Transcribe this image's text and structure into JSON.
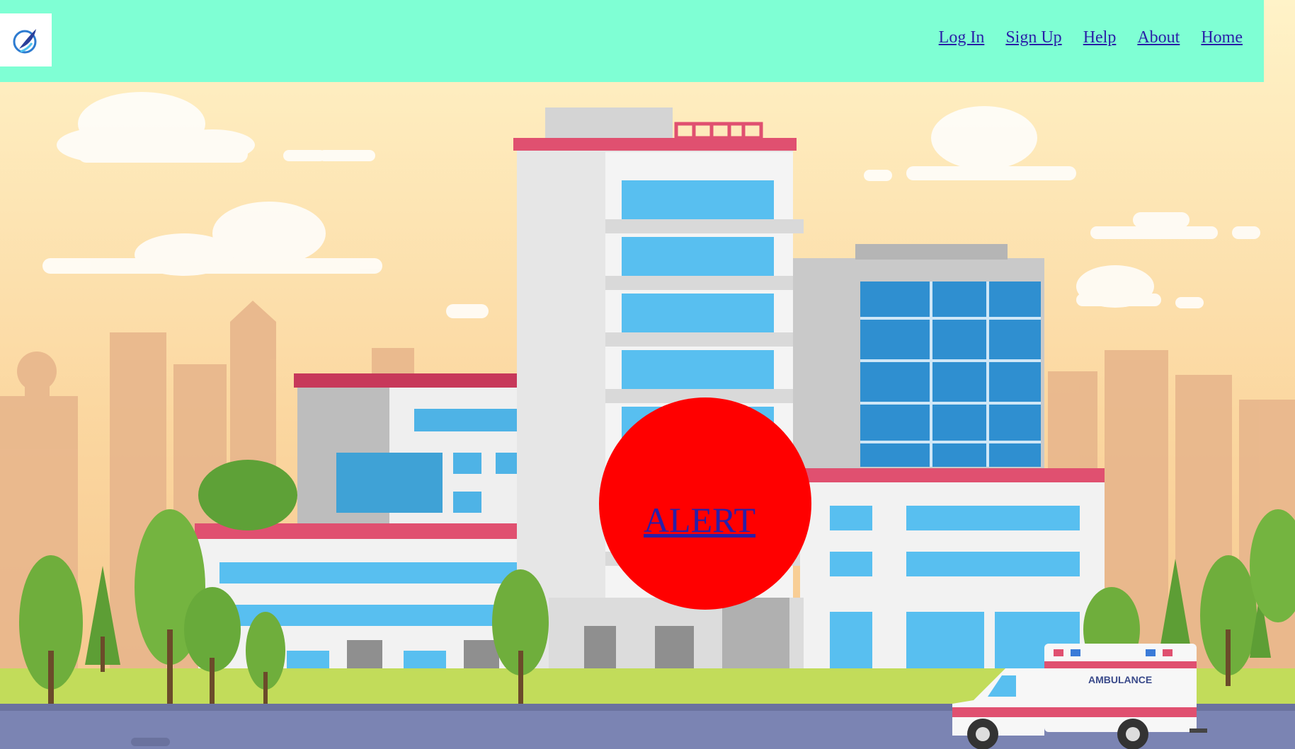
{
  "header": {
    "logo_icon": "feather-quill-logo-icon",
    "nav": [
      {
        "label": "Log In"
      },
      {
        "label": "Sign Up"
      },
      {
        "label": "Help"
      },
      {
        "label": "About"
      },
      {
        "label": "Home"
      }
    ]
  },
  "hero": {
    "illustration": "hospital-building-with-ambulance-illustration",
    "ambulance_text": "AMBULANCE"
  },
  "alert_button": {
    "label": "ALERT",
    "color": "#ff0000"
  },
  "colors": {
    "header_bg": "#7fffd4",
    "link": "#2a1fa8",
    "accent_roof": "#d9405a"
  }
}
